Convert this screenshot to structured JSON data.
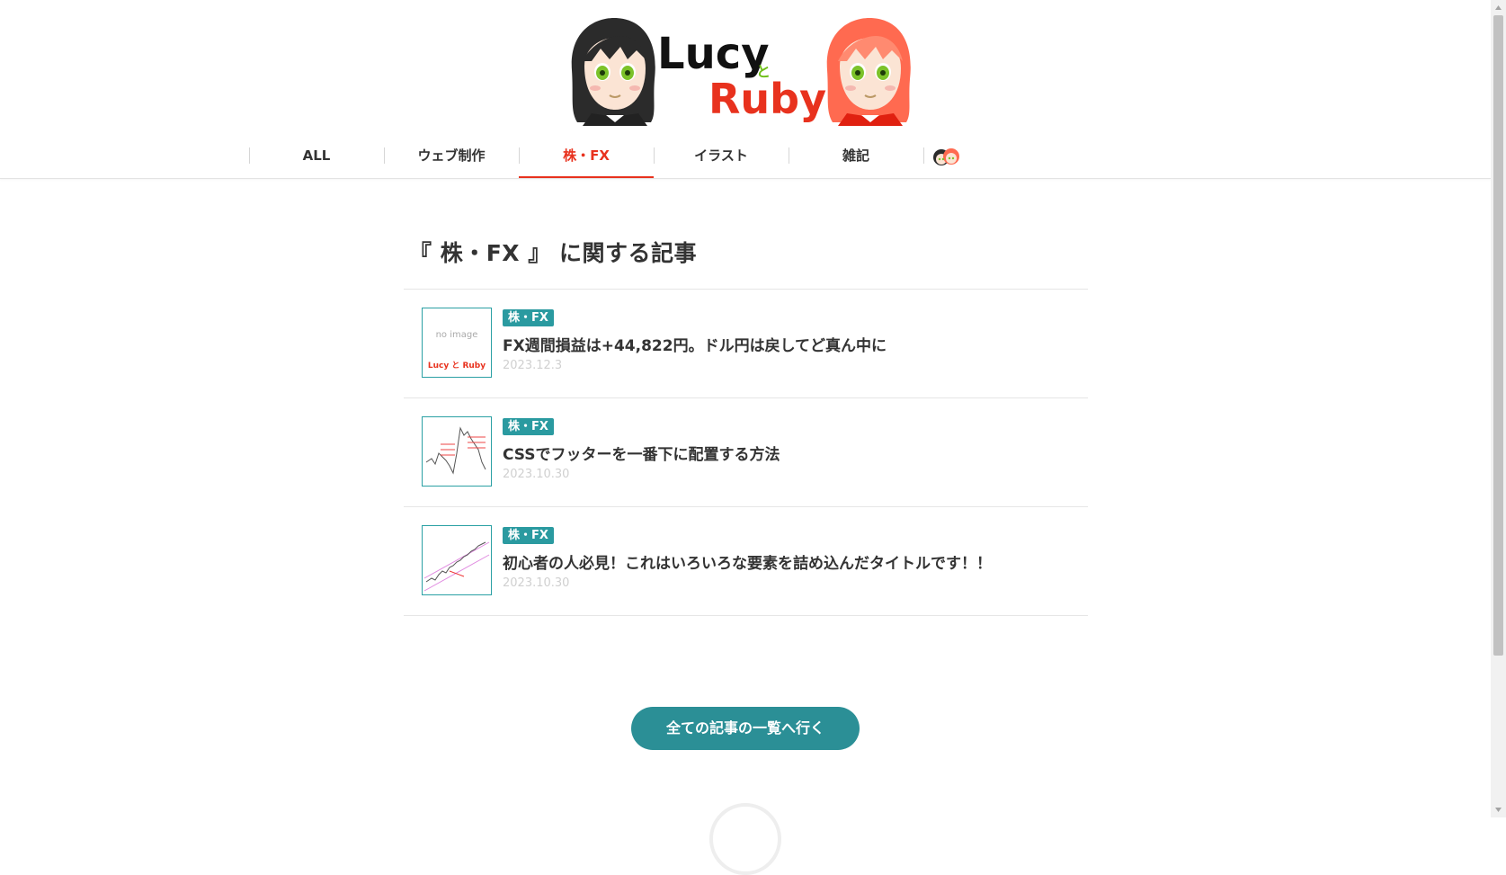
{
  "header": {
    "logo": {
      "word1": "Lucy",
      "connector": "と",
      "word2": "Ruby"
    },
    "nav": [
      {
        "label": "ALL",
        "active": false
      },
      {
        "label": "ウェブ制作",
        "active": false
      },
      {
        "label": "株・FX",
        "active": true
      },
      {
        "label": "イラスト",
        "active": false
      },
      {
        "label": "雑記",
        "active": false
      }
    ],
    "accent_color": "#e8321e"
  },
  "main": {
    "title": "『 株・FX 』 に関する記事",
    "articles": [
      {
        "tag": "株・FX",
        "title": "FX週間損益は+44,822円。ドル円は戻してど真ん中に",
        "date": "2023.12.3",
        "thumb_text": "no image",
        "thumb_logo": "Lucy と Ruby"
      },
      {
        "tag": "株・FX",
        "title": "CSSでフッターを一番下に配置する方法",
        "date": "2023.10.30"
      },
      {
        "tag": "株・FX",
        "title": "初心者の人必見！これはいろいろな要素を詰め込んだタイトルです！！",
        "date": "2023.10.30"
      }
    ],
    "all_button": "全ての記事の一覧へ行く",
    "teal_color": "#2b8f96"
  }
}
